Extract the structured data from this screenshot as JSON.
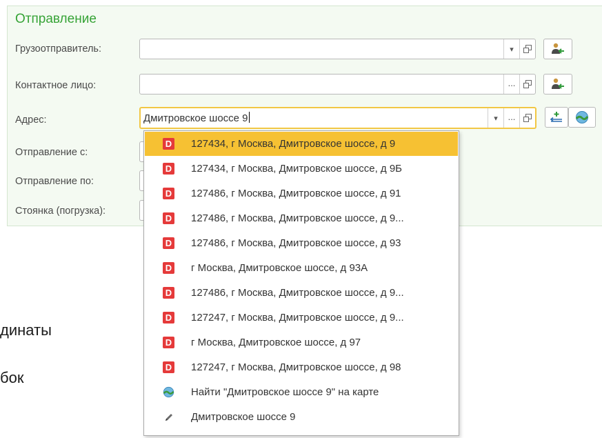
{
  "section": {
    "title": "Отправление"
  },
  "labels": {
    "shipper": "Грузоотправитель:",
    "contact": "Контактное лицо:",
    "address": "Адрес:",
    "from": "Отправление с:",
    "to": "Отправление по:",
    "parking": "Стоянка (погрузка):"
  },
  "fields": {
    "shipper_value": "",
    "contact_value": "",
    "address_value": "Дмитровское шоссе 9"
  },
  "glyphs": {
    "dropdown_arrow": "▾",
    "ellipsis": "...",
    "d_badge": "D"
  },
  "background_text": {
    "line1": "динаты",
    "line2": "бок"
  },
  "suggestions": [
    {
      "icon": "d-badge-icon",
      "text": "127434, г Москва, Дмитровское шоссе, д 9",
      "selected": true
    },
    {
      "icon": "d-badge-icon",
      "text": "127434, г Москва, Дмитровское шоссе, д 9Б",
      "selected": false
    },
    {
      "icon": "d-badge-icon",
      "text": "127486, г Москва, Дмитровское шоссе, д 91",
      "selected": false
    },
    {
      "icon": "d-badge-icon",
      "text": "127486, г Москва, Дмитровское шоссе, д 9...",
      "selected": false
    },
    {
      "icon": "d-badge-icon",
      "text": "127486, г Москва, Дмитровское шоссе, д 93",
      "selected": false
    },
    {
      "icon": "d-badge-icon",
      "text": "г Москва, Дмитровское шоссе, д 93А",
      "selected": false
    },
    {
      "icon": "d-badge-icon",
      "text": "127486, г Москва, Дмитровское шоссе, д 9...",
      "selected": false
    },
    {
      "icon": "d-badge-icon",
      "text": "127247, г Москва, Дмитровское шоссе, д 9...",
      "selected": false
    },
    {
      "icon": "d-badge-icon",
      "text": "г Москва, Дмитровское шоссе, д 97",
      "selected": false
    },
    {
      "icon": "d-badge-icon",
      "text": "127247, г Москва, Дмитровское шоссе, д 98",
      "selected": false
    },
    {
      "icon": "map-globe-icon",
      "text": "Найти \"Дмитровское шоссе 9\" на карте",
      "selected": false
    },
    {
      "icon": "pencil-icon",
      "text": "Дмитровское шоссе 9",
      "selected": false
    }
  ],
  "colors": {
    "accent_green": "#36a336",
    "selection_yellow": "#f6c133",
    "badge_red": "#e53a3a",
    "panel_bg": "#f4faf2"
  }
}
